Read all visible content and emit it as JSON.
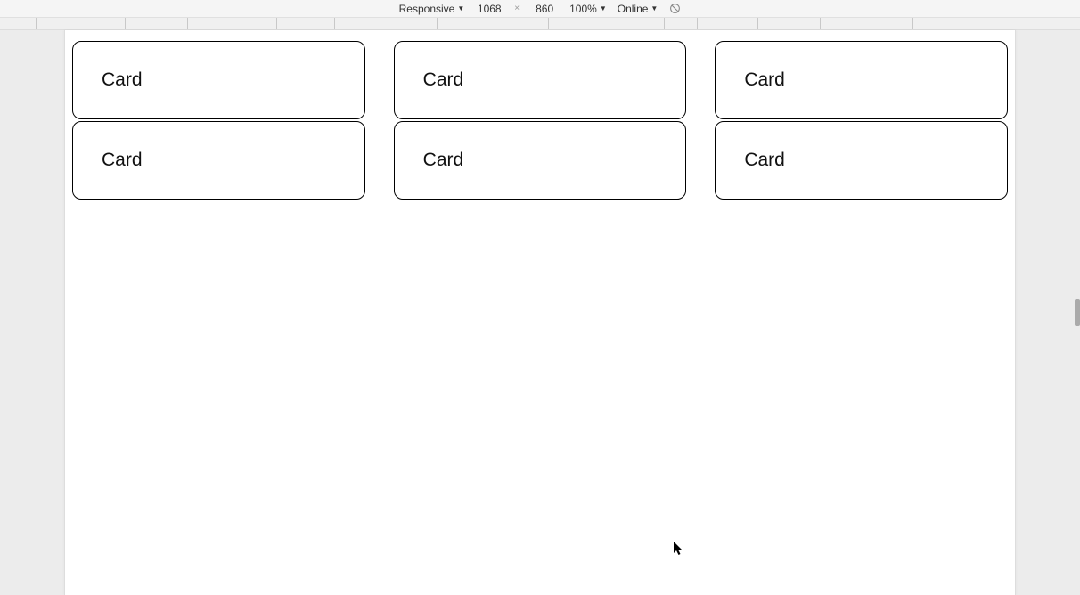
{
  "devtools": {
    "device_label": "Responsive",
    "width": "1068",
    "height": "860",
    "dim_sep": "×",
    "zoom": "100%",
    "throttle": "Online"
  },
  "cards": [
    {
      "label": "Card"
    },
    {
      "label": "Card"
    },
    {
      "label": "Card"
    },
    {
      "label": "Card"
    },
    {
      "label": "Card"
    },
    {
      "label": "Card"
    }
  ]
}
